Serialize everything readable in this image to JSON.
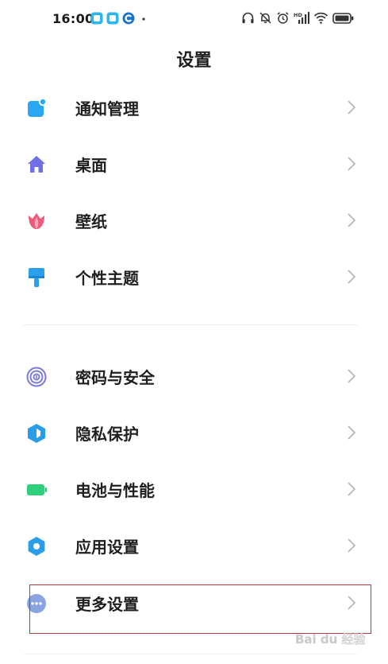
{
  "status_bar": {
    "time": "16:00",
    "left_icons": [
      "app-notification-icon",
      "app-notification-icon",
      "sync-app-icon",
      "more-dot-icon"
    ],
    "right_icons": [
      "headphones-icon",
      "mute-bell-icon",
      "alarm-icon",
      "hd-signal-icon",
      "wifi-icon",
      "battery-icon"
    ],
    "hd_label": "HD"
  },
  "header": {
    "title": "设置"
  },
  "settings": {
    "group1": [
      {
        "label": "通知管理",
        "icon": "notification-icon",
        "color": "#2aa6f2"
      },
      {
        "label": "桌面",
        "icon": "home-icon",
        "color": "#6f6fe6"
      },
      {
        "label": "壁纸",
        "icon": "tulip-icon",
        "color": "#ec5b7a"
      },
      {
        "label": "个性主题",
        "icon": "brush-icon",
        "color": "#2aa0ec"
      }
    ],
    "group2": [
      {
        "label": "密码与安全",
        "icon": "fingerprint-icon",
        "color": "#7a7ad8"
      },
      {
        "label": "隐私保护",
        "icon": "privacy-shield-icon",
        "color": "#2a9de8"
      },
      {
        "label": "电池与性能",
        "icon": "battery-performance-icon",
        "color": "#2fd07a"
      },
      {
        "label": "应用设置",
        "icon": "gear-icon",
        "color": "#2a9de8"
      },
      {
        "label": "更多设置",
        "icon": "more-icon",
        "color": "#8aa4e0"
      }
    ]
  },
  "watermark": {
    "text": "Bai du 经验"
  },
  "colors": {
    "highlight_border": "#b03a3a",
    "chevron": "#b7b7b7",
    "divider": "#ececec"
  }
}
